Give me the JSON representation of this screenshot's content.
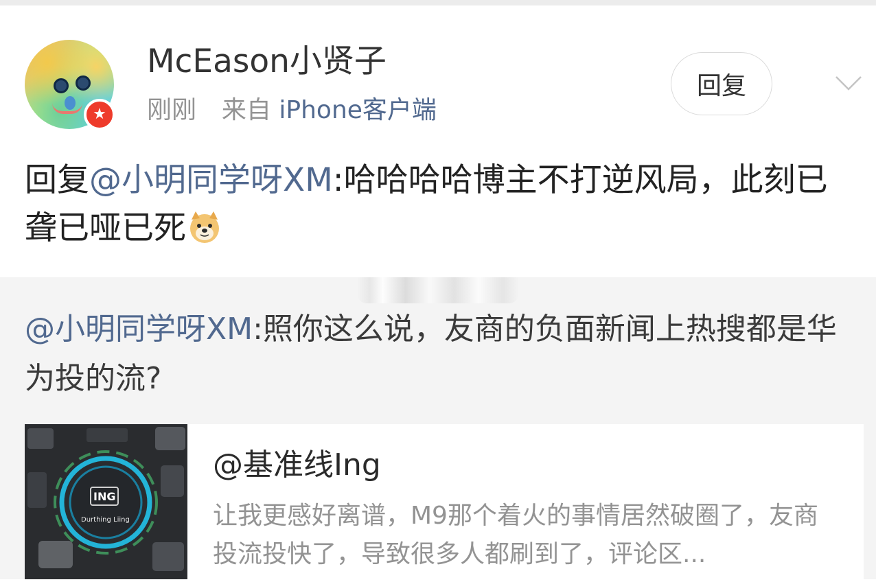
{
  "post": {
    "username": "McEason小贤子",
    "time": "刚刚",
    "source_prefix": "来自",
    "client": "iPhone客户端",
    "reply_button": "回复",
    "text_prefix": "回复",
    "mention": "@小明同学呀XM",
    "text_body": ":哈哈哈哈博主不打逆风局，此刻已聋已哑已死",
    "emoji": "doge-icon"
  },
  "quoted": {
    "mention": "@小明同学呀XM",
    "text": ":照你这么说，友商的负面新闻上热搜都是华为投的流?",
    "card": {
      "thumb_title": "ING",
      "thumb_subtitle": "Durthing Liing",
      "title": "@基准线Ing",
      "description": "让我更感好离谱，M9那个着火的事情居然破圈了，友商投流投快了，导致很多人都刷到了，评论区..."
    }
  },
  "colors": {
    "link": "#51698f",
    "badge": "#ee3b2b",
    "quoted_bg": "#f4f4f4"
  }
}
